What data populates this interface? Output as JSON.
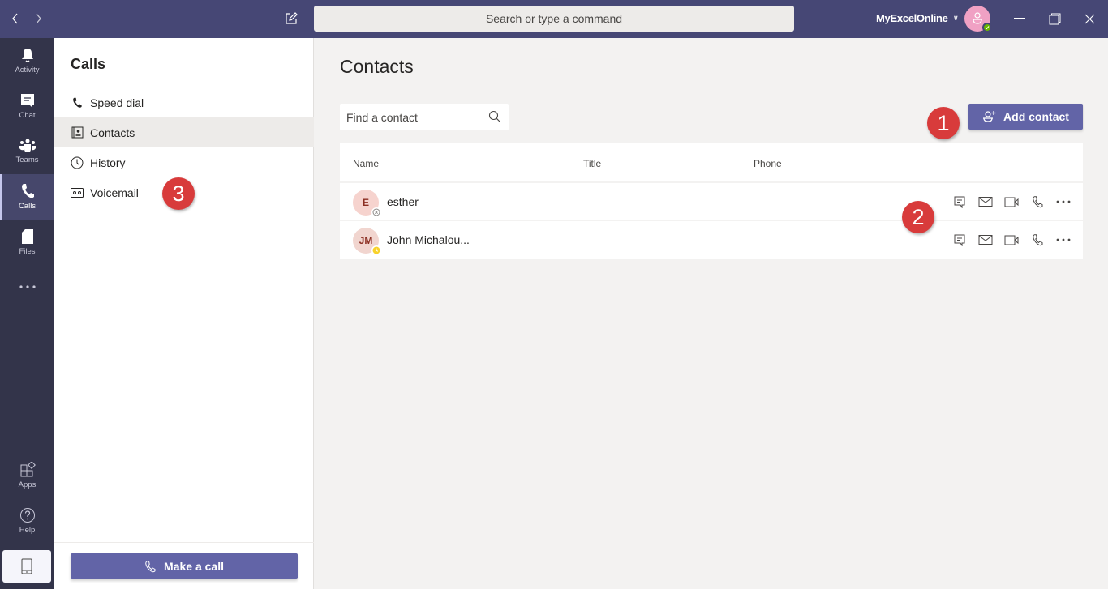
{
  "titlebar": {
    "search_placeholder": "Search or type a command",
    "org_name": "MyExcelOnline",
    "user_status": "available",
    "colors": {
      "bar": "#464775",
      "status_available": "#6bb700"
    }
  },
  "rail": {
    "items": [
      {
        "label": "Activity",
        "icon": "bell-icon"
      },
      {
        "label": "Chat",
        "icon": "chat-icon"
      },
      {
        "label": "Teams",
        "icon": "teams-icon"
      },
      {
        "label": "Calls",
        "icon": "phone-icon",
        "active": true
      },
      {
        "label": "Files",
        "icon": "file-icon"
      }
    ],
    "more_label": "•••",
    "bottom": [
      {
        "label": "Apps",
        "icon": "apps-icon"
      },
      {
        "label": "Help",
        "icon": "help-icon"
      }
    ]
  },
  "left_panel": {
    "title": "Calls",
    "items": [
      {
        "label": "Speed dial",
        "icon": "phone-icon"
      },
      {
        "label": "Contacts",
        "icon": "contact-card-icon",
        "active": true
      },
      {
        "label": "History",
        "icon": "clock-icon"
      },
      {
        "label": "Voicemail",
        "icon": "voicemail-icon"
      }
    ],
    "make_call_label": "Make a call"
  },
  "main": {
    "title": "Contacts",
    "find_placeholder": "Find a contact",
    "add_contact_label": "Add contact",
    "columns": [
      "Name",
      "Title",
      "Phone"
    ],
    "contacts": [
      {
        "initials": "E",
        "name": "esther",
        "title": "",
        "phone": "",
        "presence": "offline"
      },
      {
        "initials": "JM",
        "name": "John Michalou...",
        "title": "",
        "phone": "",
        "presence": "away"
      }
    ],
    "row_actions": [
      "chat",
      "email",
      "video-call",
      "audio-call",
      "more"
    ]
  },
  "annotations": [
    "1",
    "2",
    "3"
  ],
  "colors": {
    "brand": "#6264a7",
    "badge": "#d83b3b",
    "away": "#f8d22a"
  }
}
